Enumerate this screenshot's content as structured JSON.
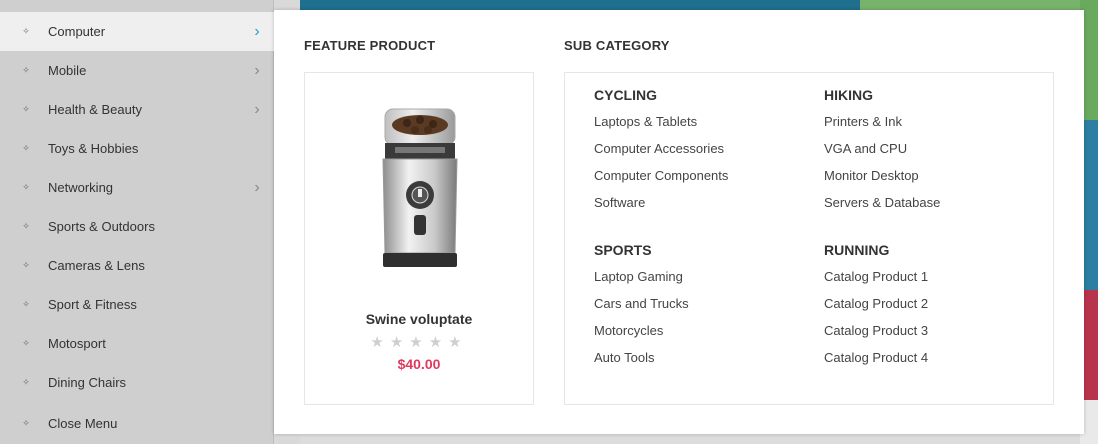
{
  "sidebar": {
    "items": [
      {
        "label": "Computer",
        "has_submenu": true,
        "active": true
      },
      {
        "label": "Mobile",
        "has_submenu": true,
        "active": false
      },
      {
        "label": "Health & Beauty",
        "has_submenu": true,
        "active": false
      },
      {
        "label": "Toys & Hobbies",
        "has_submenu": false,
        "active": false
      },
      {
        "label": "Networking",
        "has_submenu": true,
        "active": false
      },
      {
        "label": "Sports & Outdoors",
        "has_submenu": false,
        "active": false
      },
      {
        "label": "Cameras & Lens",
        "has_submenu": false,
        "active": false
      },
      {
        "label": "Sport & Fitness",
        "has_submenu": false,
        "active": false
      },
      {
        "label": "Motosport",
        "has_submenu": false,
        "active": false
      },
      {
        "label": "Dining Chairs",
        "has_submenu": false,
        "active": false
      },
      {
        "label": "Close Menu",
        "has_submenu": false,
        "active": false
      }
    ],
    "bullet_icon": "diamond-bullet-icon",
    "chevron_icon": "chevron-right-icon"
  },
  "panel": {
    "feature_title": "FEATURE PRODUCT",
    "subcategory_title": "SUB CATEGORY",
    "product": {
      "name": "Swine voluptate",
      "rating": 0,
      "rating_max": 5,
      "price": "$40.00",
      "image_icon": "coffee-grinder-image"
    },
    "groups": [
      {
        "title": "CYCLING",
        "links": [
          "Laptops & Tablets",
          "Computer Accessories",
          "Computer Components",
          "Software"
        ]
      },
      {
        "title": "HIKING",
        "links": [
          "Printers & Ink",
          "VGA and CPU",
          "Monitor Desktop",
          "Servers & Database"
        ]
      },
      {
        "title": "SPORTS",
        "links": [
          "Laptop Gaming",
          "Cars and Trucks",
          "Motorcycles",
          "Auto Tools"
        ]
      },
      {
        "title": "RUNNING",
        "links": [
          "Catalog Product 1",
          "Catalog Product 2",
          "Catalog Product 3",
          "Catalog Product 4"
        ]
      }
    ]
  },
  "colors": {
    "accent": "#21a3c6",
    "price": "#e0395e",
    "star_empty": "#cfcfcf"
  }
}
